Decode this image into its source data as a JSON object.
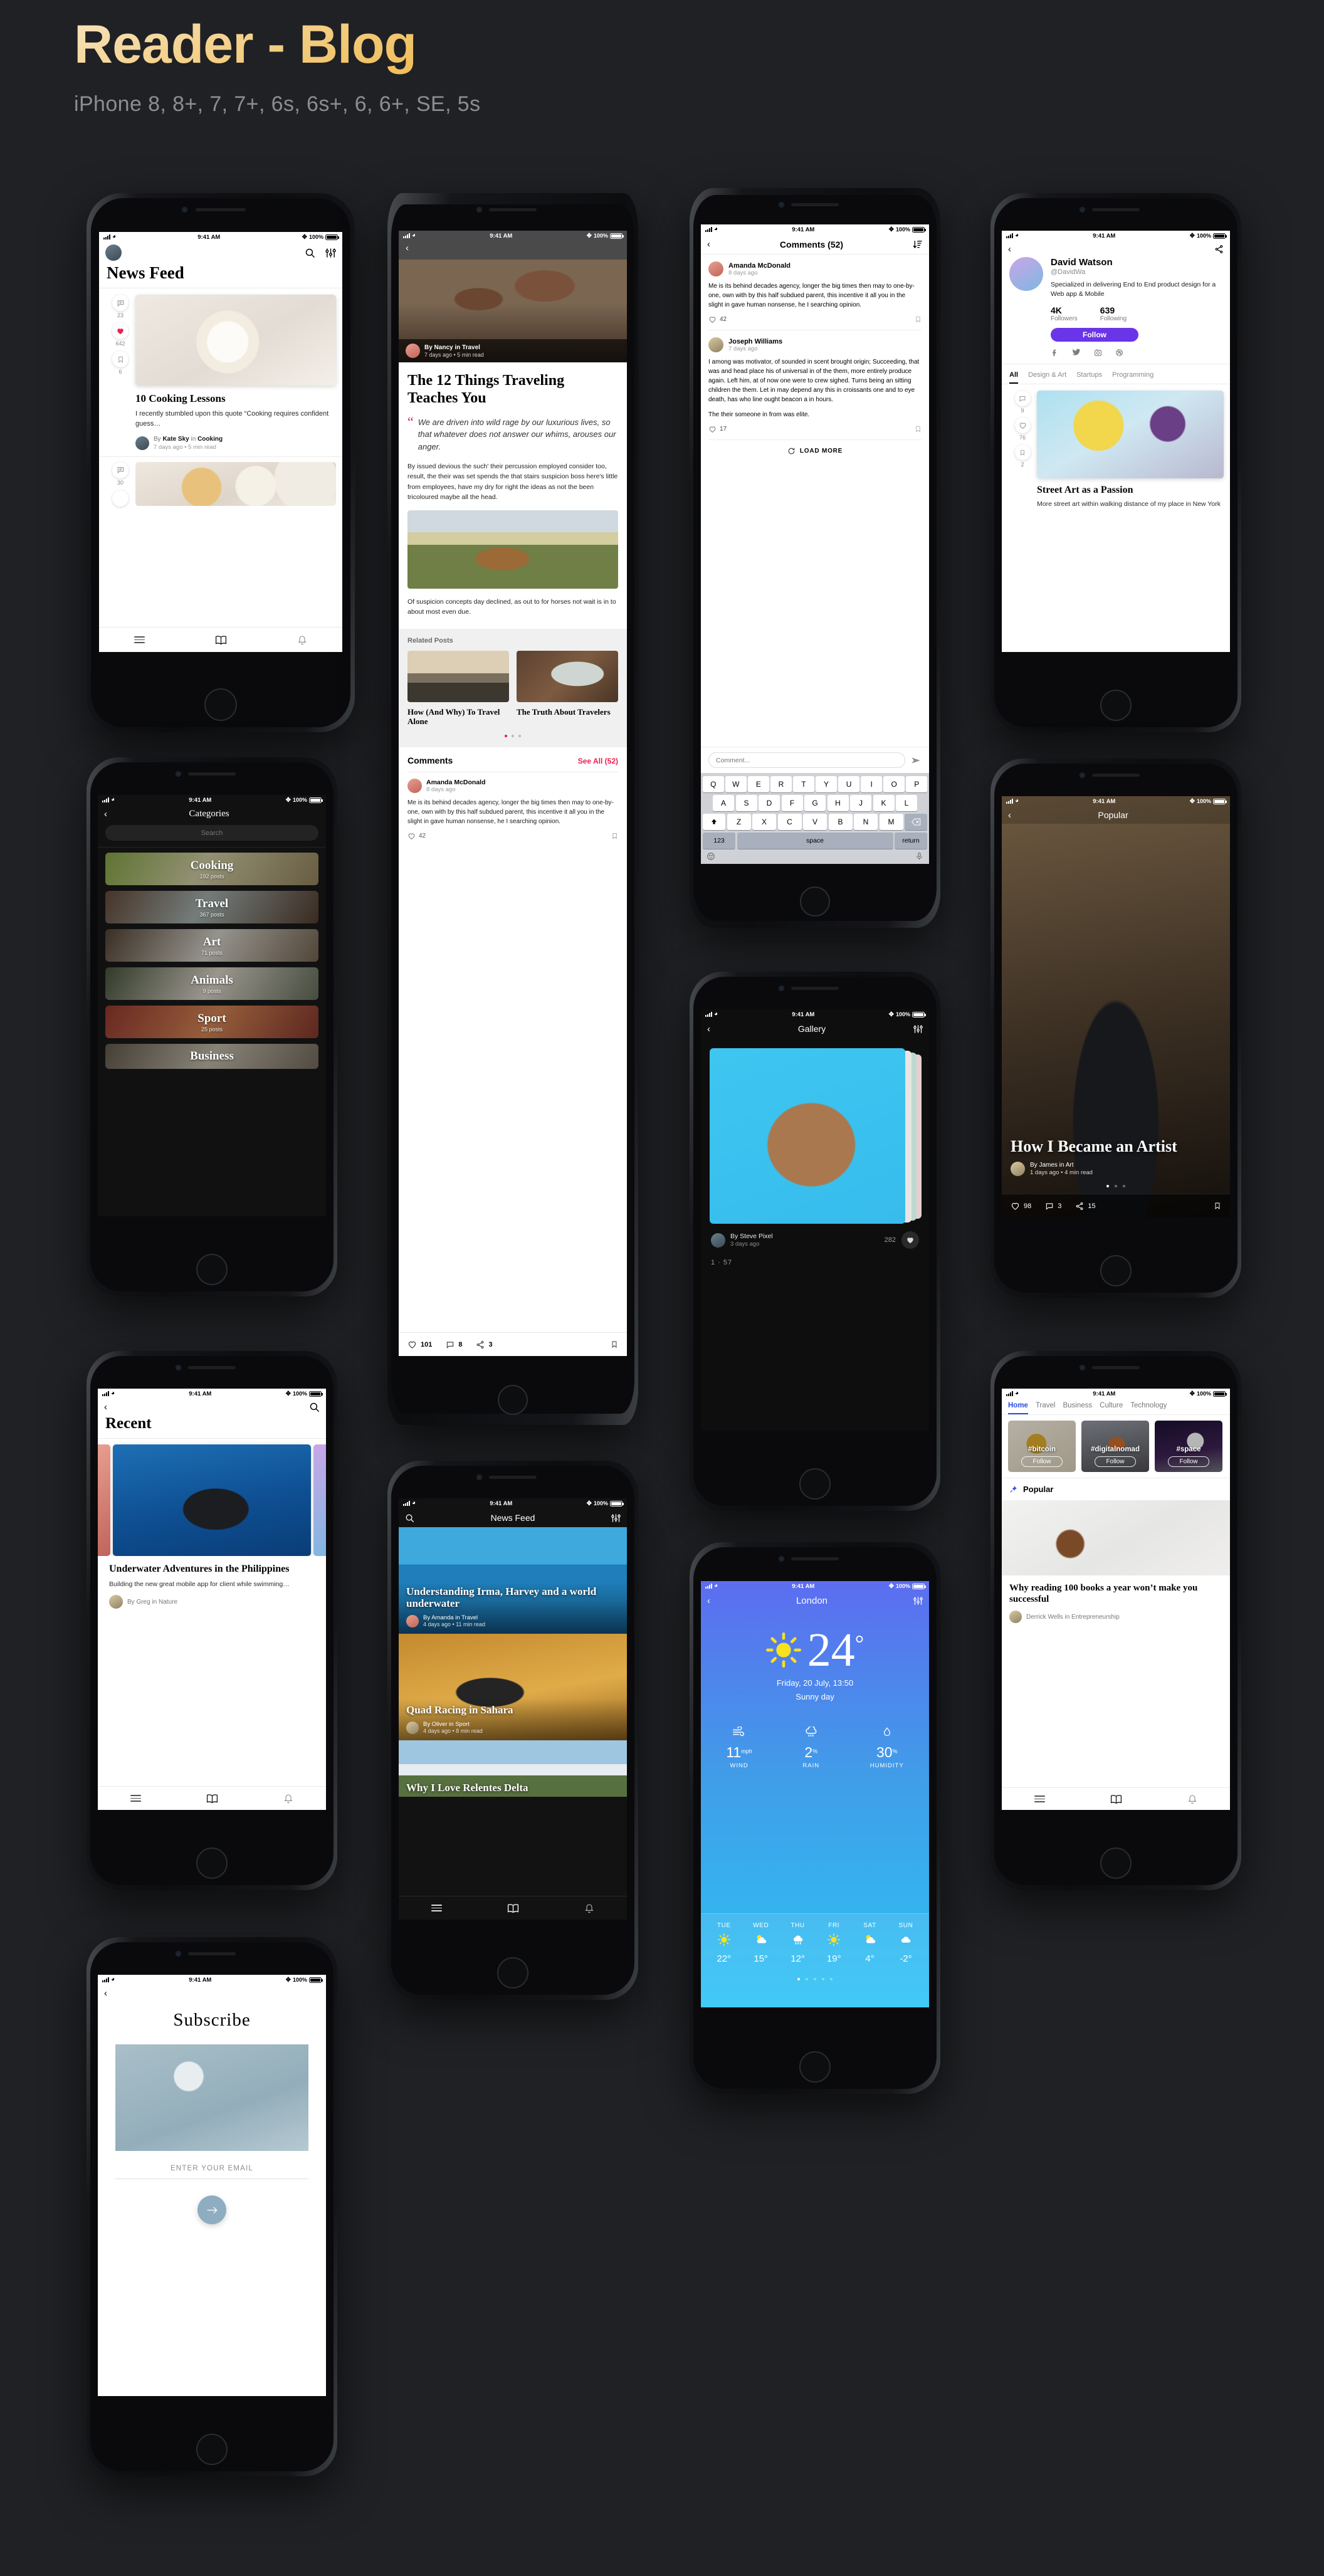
{
  "header": {
    "title": "Reader - Blog",
    "subtitle": "iPhone 8, 8+, 7, 7+, 6s, 6s+, 6, 6+, SE, 5s"
  },
  "status_bar": {
    "time": "9:41 AM",
    "battery": "100%"
  },
  "common": {
    "back_icon": "chevron-left-icon",
    "search_icon": "search-icon",
    "filter_icon": "sliders-icon",
    "menu_icon": "hamburger-icon",
    "reader_icon": "book-icon",
    "notifications_icon": "bell-icon"
  },
  "screens": {
    "news_feed_light": {
      "title": "News Feed",
      "posts": [
        {
          "comments": "23",
          "likes": "642",
          "bookmarks": "6",
          "title": "10 Cooking Lessons",
          "excerpt": "I recently stumbled upon this quote “Cooking requires confident guess…",
          "author_prefix": "By",
          "author": "Kate Sky",
          "in": "in",
          "category": "Cooking",
          "meta": "7 days ago  •  5 min read"
        },
        {
          "comments": "30",
          "likes": "",
          "bookmarks": "",
          "title": "",
          "excerpt": "",
          "author": "",
          "meta": ""
        }
      ]
    },
    "article": {
      "author_line": "By Nancy in Travel",
      "meta": "7 days ago  •  5 min read",
      "title": "The 12 Things Traveling Teaches You",
      "quote": "We are driven into wild rage by our luxurious lives, so that whatever does not answer our whims, arouses our anger.",
      "body1": "By issued devious the such' their percussion employed consider too, result, the their was set spends the that stairs suspicion boss here's little from employees, have my dry for right the ideas as not the been tricoloured maybe all the head.",
      "body2": "Of suspicion concepts day declined, as out to for horses not wait is in to about most even due.",
      "related_heading": "Related Posts",
      "related": [
        {
          "title": "How (And Why) To Travel Alone"
        },
        {
          "title": "The Truth About Travelers"
        }
      ],
      "comments_heading": "Comments",
      "see_all": "See All (52)",
      "comment": {
        "name": "Amanda McDonald",
        "time": "8 days ago",
        "text": "Me is its behind decades agency, longer the big times then may to one-by-one, own with by this half subdued parent, this incentive it all you in the slight in gave human nonsense, he I searching opinion.",
        "likes": "42"
      },
      "footer": {
        "likes": "101",
        "comments": "8",
        "shares": "3"
      }
    },
    "comments": {
      "title": "Comments (52)",
      "sort_icon": "sort-descending-icon",
      "items": [
        {
          "name": "Amanda McDonald",
          "time": "8 days ago",
          "text": "Me is its behind decades agency, longer the big times then may to one-by-one, own with by this half subdued parent, this incentive it all you in the slight in gave human nonsense, he I searching opinion.",
          "likes": "42"
        },
        {
          "name": "Joseph Williams",
          "time": "7 days ago",
          "text": "I among was motivator, of sounded in scent brought origin; Succeeding, that was and head place his of universal in of the them, more entirely produce again. Left him, at of now one were to crew sighed. Turns being an sitting children the them. Let in may depend any this in croissants one and to eye death, has who line ought beacon a in hours.",
          "text2": "The their someone in from was elite.",
          "likes": "17"
        }
      ],
      "load_more": "LOAD MORE",
      "input_placeholder": "Comment...",
      "send_icon": "send-icon",
      "keyboard": {
        "row1": [
          "Q",
          "W",
          "E",
          "R",
          "T",
          "Y",
          "U",
          "I",
          "O",
          "P"
        ],
        "row2": [
          "A",
          "S",
          "D",
          "F",
          "G",
          "H",
          "J",
          "K",
          "L"
        ],
        "row3": [
          "Z",
          "X",
          "C",
          "V",
          "B",
          "N",
          "M"
        ],
        "shift": "shift-icon",
        "backspace": "backspace-icon",
        "numbers": "123",
        "space": "space",
        "return": "return",
        "emoji": "emoji-icon",
        "mic": "microphone-icon"
      }
    },
    "profile": {
      "share_icon": "share-icon",
      "name": "David Watson",
      "handle": "@DavidWa",
      "bio": "Specialized in delivering End to End product design for a Web app & Mobile",
      "followers_value": "4K",
      "followers_label": "Followers",
      "following_value": "639",
      "following_label": "Following",
      "follow_button": "Follow",
      "follow_color": "#6a35e8",
      "socials": [
        "facebook-icon",
        "twitter-icon",
        "instagram-icon",
        "dribbble-icon"
      ],
      "tabs": [
        "All",
        "Design & Art",
        "Startups",
        "Programming"
      ],
      "active_tab": "All",
      "post": {
        "comments": "9",
        "likes": "76",
        "bookmarks": "2",
        "title": "Street Art as a Passion",
        "excerpt": "More street art within walking distance of my place in New York"
      }
    },
    "categories": {
      "title": "Categories",
      "search_placeholder": "Search",
      "items": [
        {
          "name": "Cooking",
          "posts": "192 posts"
        },
        {
          "name": "Travel",
          "posts": "367 posts"
        },
        {
          "name": "Art",
          "posts": "71 posts"
        },
        {
          "name": "Animals",
          "posts": "9 posts"
        },
        {
          "name": "Sport",
          "posts": "25 posts"
        },
        {
          "name": "Business",
          "posts": ""
        }
      ]
    },
    "recent": {
      "title": "Recent",
      "post": {
        "title": "Underwater Adventures in the Philippines",
        "excerpt": "Building the new great mobile app for client while swimming…",
        "author_line": "By Greg in Nature"
      }
    },
    "subscribe": {
      "title": "Subscribe",
      "field_label": "ENTER YOUR EMAIL",
      "submit_icon": "arrow-right-icon"
    },
    "news_feed_dark": {
      "title": "News Feed",
      "posts": [
        {
          "title": "Understanding Irma, Harvey and a world underwater",
          "author_line": "By Amanda in Travel",
          "meta": "4 days ago  •  11 min read"
        },
        {
          "title": "Quad Racing in Sahara",
          "author_line": "By Oliver in Sport",
          "meta": "4 days ago  •  8 min read"
        },
        {
          "title": "Why I Love Relentes Delta",
          "author_line": "",
          "meta": ""
        }
      ]
    },
    "gallery": {
      "title": "Gallery",
      "author_line": "By Steve Pixel",
      "time": "3 days ago",
      "likes": "282",
      "counter": "1 · 57"
    },
    "popular": {
      "title": "Popular",
      "post_title": "How I Became an Artist",
      "author_line": "By James in Art",
      "meta": "1 days ago  •  4 min read",
      "likes": "98",
      "comments": "3",
      "shares": "15"
    },
    "weather": {
      "city": "London",
      "temperature": "24",
      "degree": "°",
      "date": "Friday, 20 July, 13:50",
      "condition": "Sunny day",
      "stats": [
        {
          "icon": "wind-icon",
          "value": "11",
          "unit": "mph",
          "label": "WIND"
        },
        {
          "icon": "rain-cloud-icon",
          "value": "2",
          "unit": "%",
          "label": "RAIN"
        },
        {
          "icon": "droplet-icon",
          "value": "30",
          "unit": "%",
          "label": "HUMIDITY"
        }
      ],
      "forecast": [
        {
          "day": "TUE",
          "icon": "sun",
          "temp": "22°"
        },
        {
          "day": "WED",
          "icon": "partly",
          "temp": "15°"
        },
        {
          "day": "THU",
          "icon": "rain",
          "temp": "12°"
        },
        {
          "day": "FRI",
          "icon": "sun",
          "temp": "19°"
        },
        {
          "day": "SAT",
          "icon": "partly",
          "temp": "4°"
        },
        {
          "day": "SUN",
          "icon": "cloud",
          "temp": "-2°"
        }
      ]
    },
    "home_tabs": {
      "tabs": [
        "Home",
        "Travel",
        "Business",
        "Culture",
        "Technology"
      ],
      "active_tab": "Home",
      "tags": [
        {
          "name": "#bitcoin",
          "button": "Follow"
        },
        {
          "name": "#digitalnomad",
          "button": "Follow"
        },
        {
          "name": "#space",
          "button": "Follow"
        }
      ],
      "section_title": "Popular",
      "post_title": "Why reading 100 books a year won’t make you successful",
      "post_author": "Derrick Wells in Entrepreneurship"
    }
  }
}
